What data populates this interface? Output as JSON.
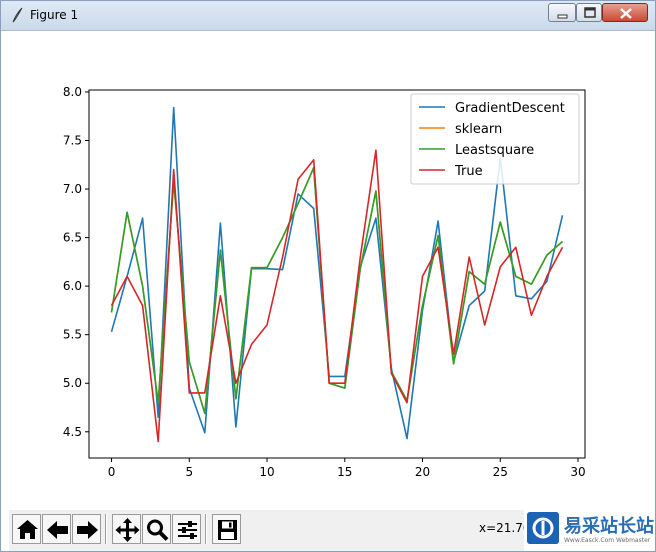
{
  "window": {
    "title": "Figure 1",
    "minimize_icon": "minimize-icon",
    "maximize_icon": "maximize-icon",
    "close_icon": "close-icon"
  },
  "toolbar": {
    "buttons": [
      {
        "name": "home-button",
        "icon": "home-icon"
      },
      {
        "name": "back-button",
        "icon": "arrow-left-icon"
      },
      {
        "name": "forward-button",
        "icon": "arrow-right-icon"
      },
      {
        "name": "pan-button",
        "icon": "move-icon"
      },
      {
        "name": "zoom-button",
        "icon": "magnifier-icon"
      },
      {
        "name": "configure-subplots-button",
        "icon": "sliders-icon"
      },
      {
        "name": "save-button",
        "icon": "floppy-disk-icon"
      }
    ],
    "coords": "x=21.70"
  },
  "watermark": {
    "main": "易采站长站",
    "sub": "Www.Easck.Com  Webmaster"
  },
  "chart_data": {
    "type": "line",
    "title": "",
    "xlabel": "",
    "ylabel": "",
    "xlim": [
      -1.45,
      30.45
    ],
    "ylim": [
      4.23,
      8.02
    ],
    "xticks": [
      0,
      5,
      10,
      15,
      20,
      25,
      30
    ],
    "yticks": [
      4.5,
      5.0,
      5.5,
      6.0,
      6.5,
      7.0,
      7.5,
      8.0
    ],
    "xtick_labels": [
      "0",
      "5",
      "10",
      "15",
      "20",
      "25",
      "30"
    ],
    "ytick_labels": [
      "4.5",
      "5.0",
      "5.5",
      "6.0",
      "6.5",
      "7.0",
      "7.5",
      "8.0"
    ],
    "grid": false,
    "legend_position": "top-right",
    "x": [
      0,
      1,
      2,
      3,
      4,
      5,
      6,
      7,
      8,
      9,
      10,
      11,
      12,
      13,
      14,
      15,
      16,
      17,
      18,
      19,
      20,
      21,
      22,
      23,
      24,
      25,
      26,
      27,
      28,
      29
    ],
    "series": [
      {
        "name": "GradientDescent",
        "color": "#1f77b4",
        "values": [
          5.53,
          6.1,
          6.7,
          4.65,
          7.84,
          4.95,
          4.49,
          6.65,
          4.55,
          6.18,
          6.18,
          6.17,
          6.95,
          6.8,
          5.07,
          5.07,
          6.2,
          6.7,
          5.15,
          4.43,
          5.75,
          6.67,
          5.22,
          5.8,
          5.95,
          7.32,
          5.9,
          5.87,
          6.05,
          6.73
        ]
      },
      {
        "name": "sklearn",
        "color": "#ff7f0e",
        "values": [
          5.73,
          6.76,
          6.0,
          4.8,
          7.08,
          5.22,
          4.69,
          6.37,
          4.84,
          6.19,
          6.19,
          6.5,
          6.85,
          7.22,
          5.0,
          4.95,
          6.18,
          6.98,
          5.12,
          4.82,
          5.8,
          6.52,
          5.2,
          6.15,
          6.02,
          6.66,
          6.1,
          6.02,
          6.32,
          6.46
        ]
      },
      {
        "name": "Leastsquare",
        "color": "#2ca02c",
        "values": [
          5.73,
          6.76,
          6.0,
          4.8,
          7.08,
          5.22,
          4.69,
          6.37,
          4.84,
          6.19,
          6.19,
          6.5,
          6.85,
          7.22,
          5.0,
          4.95,
          6.18,
          6.98,
          5.12,
          4.82,
          5.8,
          6.52,
          5.2,
          6.15,
          6.02,
          6.66,
          6.1,
          6.02,
          6.32,
          6.46
        ]
      },
      {
        "name": "True",
        "color": "#d62728",
        "values": [
          5.8,
          6.1,
          5.8,
          4.4,
          7.2,
          4.9,
          4.9,
          5.9,
          5.0,
          5.4,
          5.6,
          6.3,
          7.1,
          7.3,
          5.0,
          5.0,
          6.3,
          7.4,
          5.1,
          4.8,
          6.1,
          6.4,
          5.3,
          6.3,
          5.6,
          6.2,
          6.4,
          5.7,
          6.1,
          6.4
        ]
      }
    ]
  }
}
